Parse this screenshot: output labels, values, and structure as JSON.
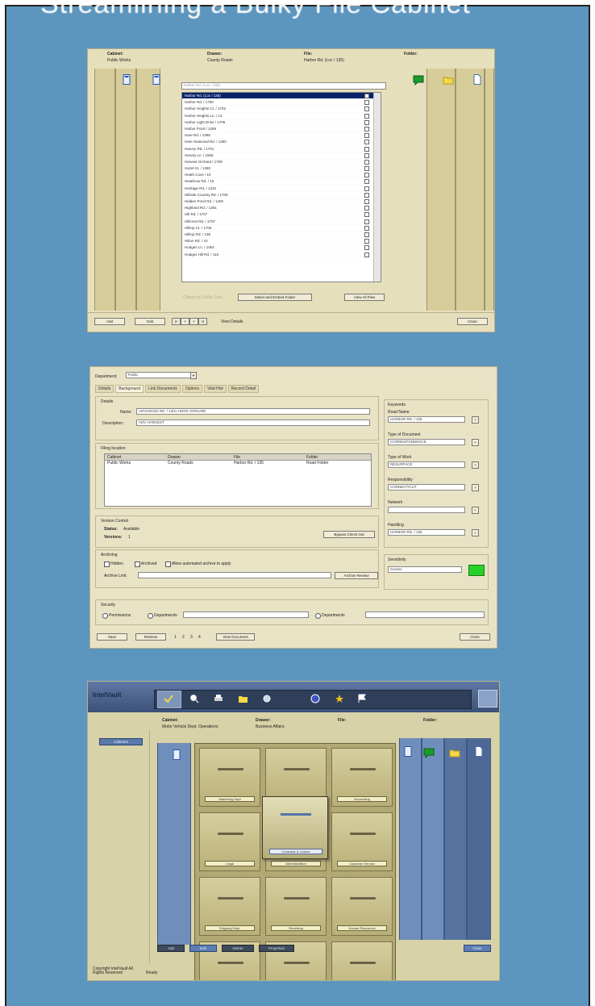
{
  "slide": {
    "title": "Streamlining a Bulky File Cabinet"
  },
  "shot1": {
    "headers": [
      "Cabinet:",
      "Drawer:",
      "File:",
      "Folder:"
    ],
    "values": [
      "Public Works",
      "County Roads",
      "Harbor Rd. (Loc / 135)",
      ""
    ],
    "filter_text": "Harbor Rd. (Loc / 135)",
    "list_items": [
      "Harbor Rd. (Loc / 135)",
      "Harbor Rd. / 1700",
      "Harbor Heights Ct. / 1702",
      "Harbor Heights Ln. / 13",
      "Harbor Light Drive / 1705",
      "Harbor Point / 1269",
      "Hare Rd. / 1398",
      "Hare Seasonal Rd. / 1360",
      "Harvey Rd. / 1701",
      "Harvey Ln. / 1506",
      "Harvest Orchard / 1708",
      "Hazel St. / 1480",
      "Heath Cove / 10",
      "Heathrow Rd. / 10",
      "Heritage Rd. / 1310",
      "Hillside Country Rd. / 1709",
      "Hidden Pond Rd. / 1400",
      "Highland Rd. / 1361",
      "Hill Rd. / 1707",
      "Hillcrest Rd. / 1707",
      "Hilltop Ct. / 1706",
      "Hilltop Rd. / 135",
      "Hilton Rd. / 10",
      "Hodges Ln. / 1054",
      "Hodges Hill Rd. / 110"
    ],
    "footer_faint": "Check for Folder Files",
    "btn_select": "Select and Embed Folder",
    "btn_view": "View All Files",
    "btn_add": "Add",
    "btn_edit": "Edit",
    "nav": [
      "|<",
      "<",
      ">",
      ">|"
    ],
    "view_details": "View Details",
    "btn_close": "Close"
  },
  "shot2": {
    "department_label": "Department:",
    "department_value": "Public",
    "tabs": [
      "Details",
      "Background",
      "Link Documents",
      "Options",
      "Vital Hist",
      "Record Detail"
    ],
    "details_title": "Details",
    "name_label": "Name:",
    "name_value": "ADVANCED RD. / 1401 HOOK GROUND",
    "description_label": "Description:",
    "description_value": "ADV HARVEST",
    "filing_title": "Filing location",
    "filing_headers": [
      "Cabinet",
      "Drawer",
      "File",
      "Folder"
    ],
    "filing_row": [
      "Public Works",
      "County Roads",
      "Harbor Rd. / 135",
      "Road Folder"
    ],
    "version_title": "Version Control",
    "status_label": "Status:",
    "status_value": "Available",
    "versions_label": "Versions:",
    "versions_value": "1",
    "bypass_btn": "Bypass Check Out",
    "archiving_title": "Archiving",
    "archive_opts": [
      "Hidden",
      "Archived",
      "Allow automated archive to apply"
    ],
    "archive_link_label": "Archive Link:",
    "archive_btn": "Archive Review",
    "security_title": "Security",
    "security_opts": [
      "Permissions",
      "Departments",
      "Departments"
    ],
    "keywords_title": "Keywords",
    "right_fields": [
      {
        "label": "Road Name",
        "value": "HARBOR RD. / 135"
      },
      {
        "label": "Type of Document",
        "value": "CORRESPONDENCE"
      },
      {
        "label": "Type of Work",
        "value": "RESURFACE"
      },
      {
        "label": "Responsibility",
        "value": "CONNECTICUT"
      },
      {
        "label": "Network",
        "value": ""
      },
      {
        "label": "Handling",
        "value": "HARBOR RD. / 135"
      }
    ],
    "sensitivity_title": "Sensitivity",
    "sensitivity_value": "Sussex",
    "btn_save": "Save",
    "btn_retrieve": "Retrieve",
    "nav": [
      "1",
      "2",
      "3",
      "4"
    ],
    "view_document": "View Document",
    "btn_close": "Close"
  },
  "shot3": {
    "brand": "IntelVault",
    "toolbar_icons": [
      "check-icon",
      "search-icon",
      "print-icon",
      "folder-icon",
      "zoom-icon",
      "help-icon",
      "star-icon",
      "flag-icon"
    ],
    "headers": [
      "Cabinet:",
      "Drawer:",
      "File:",
      "Folder:"
    ],
    "values": [
      "Motor Vehicle Dept. Operations",
      "Business Affairs",
      "",
      ""
    ],
    "side_button": "Cabinets",
    "drawer_labels": [
      "Marketing Dept",
      "Sales",
      "Accounting",
      "Legal",
      "Administration",
      "Customer Service",
      "Shipping Dept.",
      "Receiving",
      "Human Resources",
      "Research & Dev.",
      "",
      ""
    ],
    "open_drawer_label": "Contracts & Leases",
    "bottom_buttons": [
      "Add",
      "Edit",
      "Delete",
      "Properties"
    ],
    "bottom_right_btn": "Close",
    "status_left": "Copyright IntelVault All Rights Reserved",
    "status_ready": "Ready"
  }
}
